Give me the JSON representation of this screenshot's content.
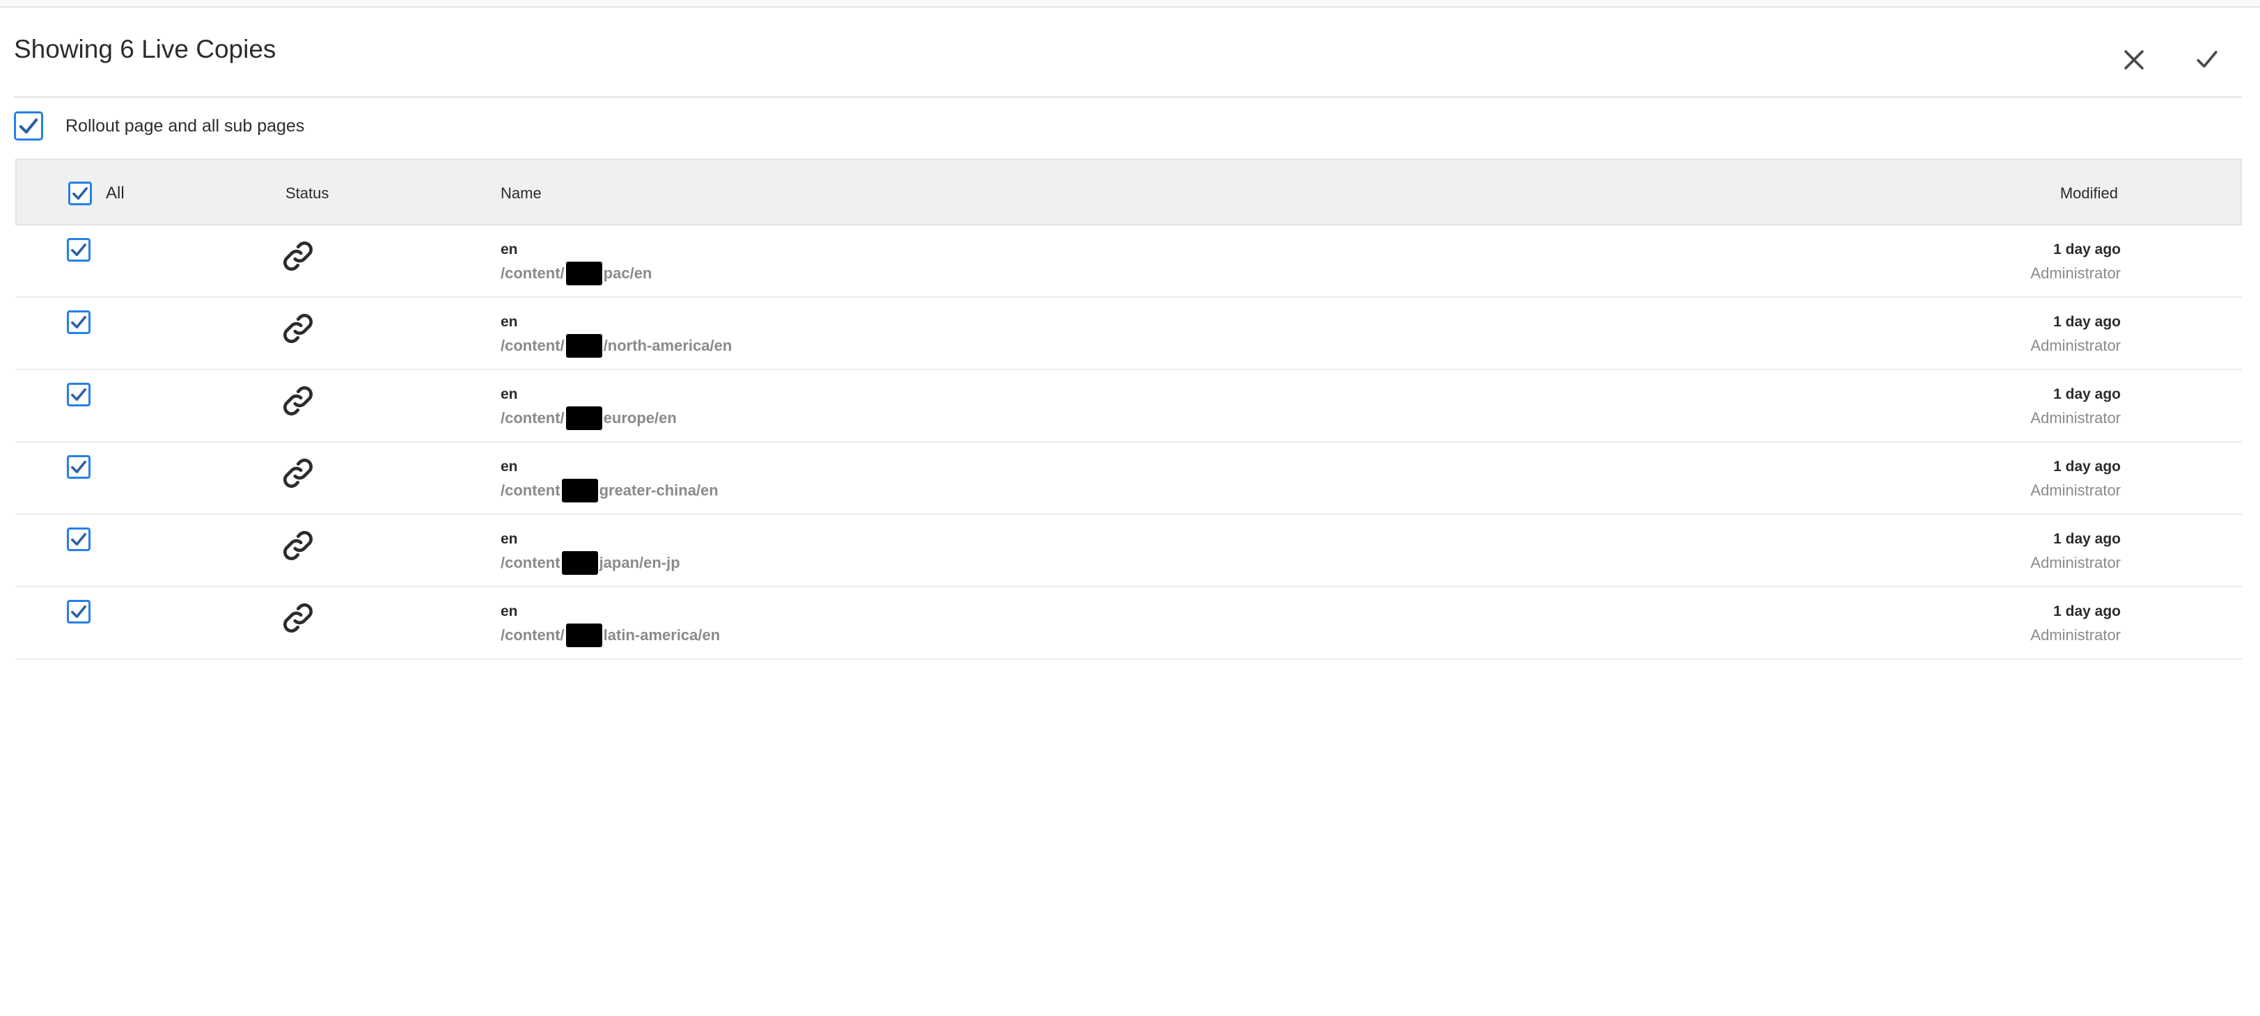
{
  "dialog": {
    "title": "Showing 6 Live Copies",
    "close_icon": "close-icon",
    "confirm_icon": "checkmark-icon"
  },
  "rollout": {
    "label": "Rollout page and all sub pages",
    "checked": true
  },
  "table": {
    "columns": {
      "all": "All",
      "status": "Status",
      "name": "Name",
      "modified": "Modified"
    },
    "rows": [
      {
        "checked": true,
        "status_icon": "link-icon",
        "name": "en",
        "path_prefix": "/content/",
        "path_suffix": "pac/en",
        "modified": "1 day ago",
        "user": "Administrator"
      },
      {
        "checked": true,
        "status_icon": "link-icon",
        "name": "en",
        "path_prefix": "/content/",
        "path_suffix": "/north-america/en",
        "modified": "1 day ago",
        "user": "Administrator"
      },
      {
        "checked": true,
        "status_icon": "link-icon",
        "name": "en",
        "path_prefix": "/content/",
        "path_suffix": "europe/en",
        "modified": "1 day ago",
        "user": "Administrator"
      },
      {
        "checked": true,
        "status_icon": "link-icon",
        "name": "en",
        "path_prefix": "/content",
        "path_suffix": "greater-china/en",
        "modified": "1 day ago",
        "user": "Administrator"
      },
      {
        "checked": true,
        "status_icon": "link-icon",
        "name": "en",
        "path_prefix": "/content",
        "path_suffix": "japan/en-jp",
        "modified": "1 day ago",
        "user": "Administrator"
      },
      {
        "checked": true,
        "status_icon": "link-icon",
        "name": "en",
        "path_prefix": "/content/",
        "path_suffix": "latin-america/en",
        "modified": "1 day ago",
        "user": "Administrator"
      }
    ]
  },
  "colors": {
    "accent": "#2680eb",
    "header_bg": "#f0f0f0",
    "muted_text": "#8a8a8a"
  }
}
